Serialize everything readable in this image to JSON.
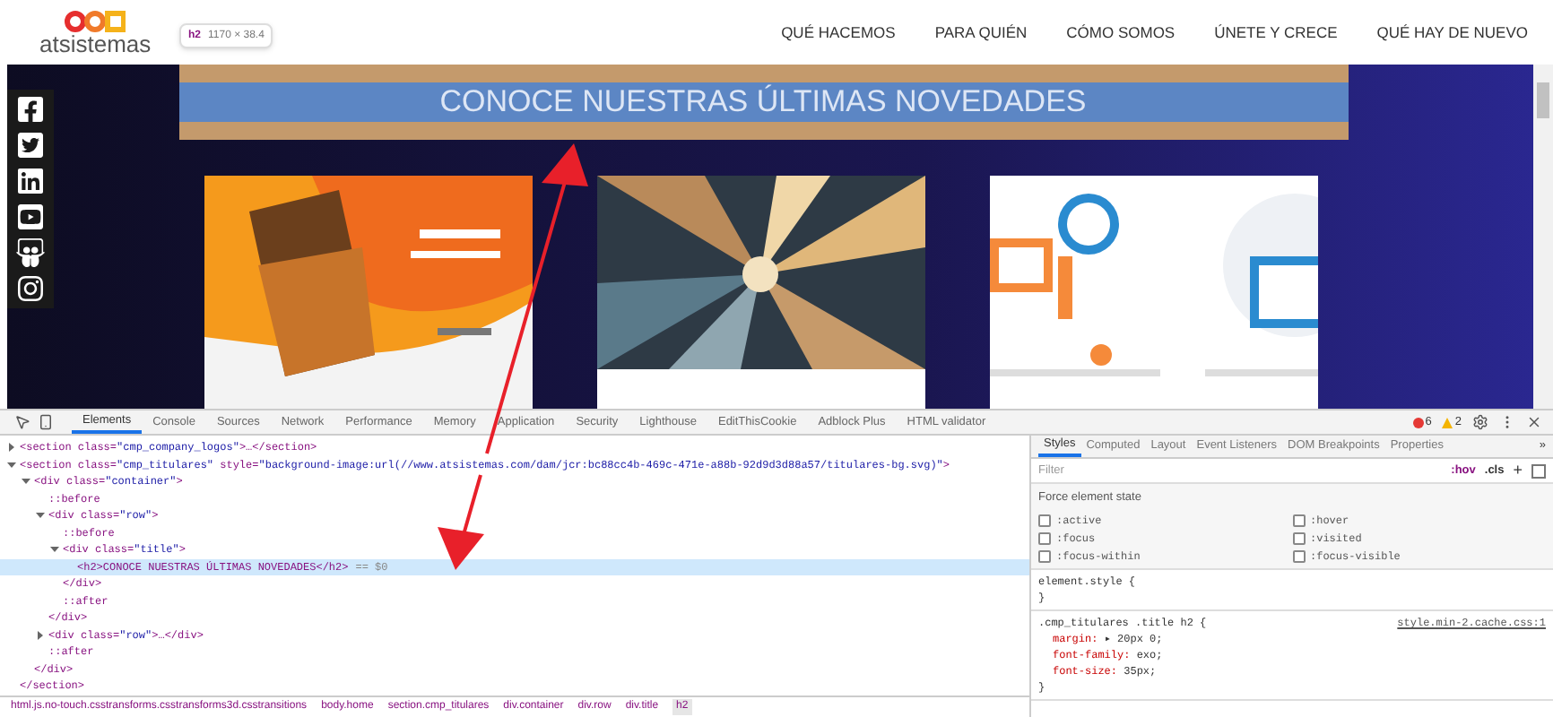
{
  "site": {
    "logo": "atsistemas",
    "nav": [
      "QUÉ HACEMOS",
      "PARA QUIÉN",
      "CÓMO SOMOS",
      "ÚNETE Y CRECE",
      "QUÉ HAY DE NUEVO"
    ],
    "tooltip": {
      "tag": "h2",
      "size": "1170 × 38.4"
    },
    "heading": "CONOCE NUESTRAS ÚLTIMAS NOVEDADES",
    "cards": [
      {
        "kind": "picture"
      },
      {
        "kind": "picture"
      },
      {
        "kind": "picture"
      }
    ]
  },
  "devtools": {
    "tabs": [
      {
        "label": "Elements",
        "selected": true
      },
      {
        "label": "Console",
        "selected": false
      },
      {
        "label": "Sources",
        "selected": false
      },
      {
        "label": "Network",
        "selected": false
      },
      {
        "label": "Performance",
        "selected": false
      },
      {
        "label": "Memory",
        "selected": false
      },
      {
        "label": "Application",
        "selected": false
      },
      {
        "label": "Security",
        "selected": false
      },
      {
        "label": "Lighthouse",
        "selected": false
      },
      {
        "label": "EditThisCookie",
        "selected": false
      },
      {
        "label": "Adblock Plus",
        "selected": false
      },
      {
        "label": "HTML validator",
        "selected": false
      }
    ],
    "errors": "6",
    "warnings": "2",
    "tree": [
      {
        "kind": "element",
        "text": "<section class=\"cmp_company_logos\">…</section>",
        "expanded": false,
        "selected": false
      },
      {
        "kind": "element",
        "text": "<section class=\"cmp_titulares\" style=\"background-image:url(//www.atsistemas.com/dam/jcr:bc88cc4b-469c-471e-a88b-92d9d3d88a57/titulares-bg.svg)\">",
        "expanded": true,
        "selected": false,
        "close": "</section>",
        "children": [
          {
            "kind": "element",
            "text": "<div class=\"container\">",
            "expanded": true,
            "selected": false,
            "close": "</div>",
            "children": [
              {
                "kind": "pseudo",
                "text": "::before",
                "selected": false
              },
              {
                "kind": "element",
                "text": "<div class=\"row\">",
                "expanded": true,
                "selected": false,
                "close": "</div>",
                "children": [
                  {
                    "kind": "pseudo",
                    "text": "::before",
                    "selected": false
                  },
                  {
                    "kind": "element",
                    "text": "<div class=\"title\">",
                    "expanded": true,
                    "selected": false,
                    "close": "</div>",
                    "children": [
                      {
                        "kind": "leaf",
                        "text": "<h2>CONOCE NUESTRAS ÚLTIMAS NOVEDADES</h2>",
                        "selected": true,
                        "suffix": "== $0"
                      }
                    ]
                  },
                  {
                    "kind": "pseudo",
                    "text": "::after",
                    "selected": false
                  }
                ]
              },
              {
                "kind": "element",
                "text": "<div class=\"row\">…</div>",
                "expanded": false,
                "selected": false
              },
              {
                "kind": "pseudo",
                "text": "::after",
                "selected": false
              }
            ]
          }
        ]
      }
    ],
    "breadcrumbs": [
      {
        "label": "html.js.no-touch.csstransforms.csstransforms3d.csstransitions",
        "selected": false
      },
      {
        "label": "body.home",
        "selected": false
      },
      {
        "label": "section.cmp_titulares",
        "selected": false
      },
      {
        "label": "div.container",
        "selected": false
      },
      {
        "label": "div.row",
        "selected": false
      },
      {
        "label": "div.title",
        "selected": false
      },
      {
        "label": "h2",
        "selected": true
      }
    ],
    "styles": {
      "tabs": [
        {
          "label": "Styles",
          "selected": true
        },
        {
          "label": "Computed",
          "selected": false
        },
        {
          "label": "Layout",
          "selected": false
        },
        {
          "label": "Event Listeners",
          "selected": false
        },
        {
          "label": "DOM Breakpoints",
          "selected": false
        },
        {
          "label": "Properties",
          "selected": false
        }
      ],
      "more": "»",
      "filter": {
        "placeholder": "Filter"
      },
      "hov": ":hov",
      "cls": ".cls",
      "add": "+",
      "force_title": "Force element state",
      "states": [
        {
          "label": ":active",
          "checked": false
        },
        {
          "label": ":hover",
          "checked": false
        },
        {
          "label": ":focus",
          "checked": false
        },
        {
          "label": ":visited",
          "checked": false
        },
        {
          "label": ":focus-within",
          "checked": false
        },
        {
          "label": ":focus-visible",
          "checked": false
        }
      ],
      "rules": [
        {
          "selector": "element.style {",
          "close": "}"
        },
        {
          "selector": ".cmp_titulares .title h2 {",
          "source": "style.min-2.cache.css:1",
          "declarations": [
            {
              "prop": "margin:",
              "value": "▸ 20px 0;"
            },
            {
              "prop": "font-family:",
              "value": "exo;"
            },
            {
              "prop": "font-size:",
              "value": "35px;"
            }
          ],
          "close": "}"
        }
      ]
    }
  }
}
